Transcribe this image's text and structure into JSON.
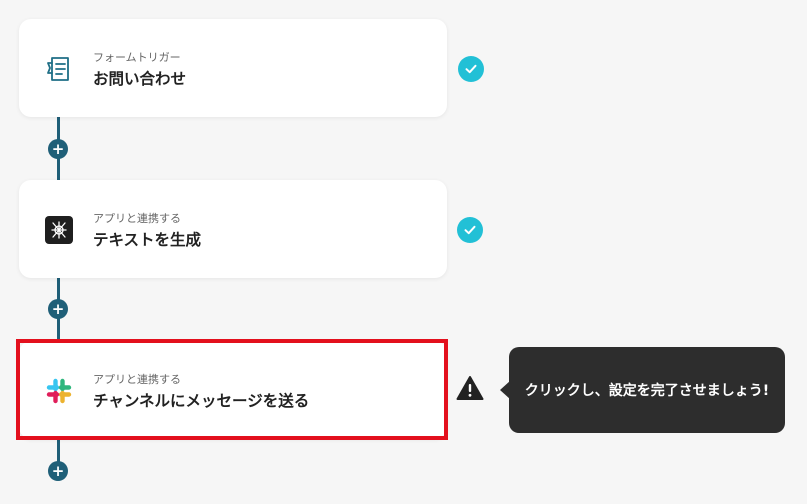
{
  "flow": {
    "steps": [
      {
        "subtitle": "フォームトリガー",
        "title": "お問い合わせ",
        "icon": "form-icon",
        "status": "complete"
      },
      {
        "subtitle": "アプリと連携する",
        "title": "テキストを生成",
        "icon": "ai-app-icon",
        "status": "complete"
      },
      {
        "subtitle": "アプリと連携する",
        "title": "チャンネルにメッセージを送る",
        "icon": "slack-icon",
        "status": "warning"
      }
    ],
    "add_button_label": "+"
  },
  "tooltip": {
    "text": "クリックし、設定を完了させましょう!"
  },
  "colors": {
    "connector": "#1f5f78",
    "check": "#22c0d6",
    "highlight": "#e3101d",
    "tooltip_bg": "#2d2d2d"
  }
}
